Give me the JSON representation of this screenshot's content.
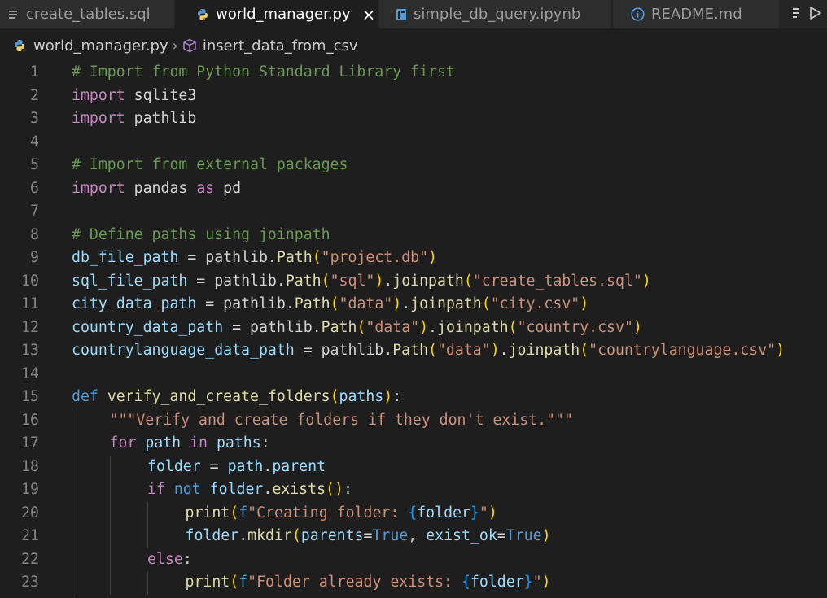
{
  "tabs": [
    {
      "label": "create_tables.sql",
      "icon": "sql-file-icon",
      "active": false
    },
    {
      "label": "world_manager.py",
      "icon": "python-file-icon",
      "active": true,
      "close": "×"
    },
    {
      "label": "simple_db_query.ipynb",
      "icon": "notebook-file-icon",
      "active": false
    },
    {
      "label": "README.md",
      "icon": "info-icon",
      "active": false
    }
  ],
  "tab_actions": {
    "icons": [
      "overflow-menu-icon",
      "run-icon"
    ]
  },
  "breadcrumb": {
    "file": "world_manager.py",
    "separator": "›",
    "symbol": "insert_data_from_csv",
    "symbol_icon": "method-cube-icon"
  },
  "colors": {
    "comment": "#6a9955",
    "keyword": "#569cd6",
    "control": "#c586c0",
    "string": "#ce9178",
    "function": "#dcdcaa",
    "variable": "#9cdcfe",
    "text": "#d4d4d4",
    "bracket1": "#ffd700",
    "bracket2": "#da70d6",
    "bracket3": "#179fff",
    "line_number": "#858585"
  },
  "editor": {
    "lines": [
      {
        "n": "1",
        "indent": 0,
        "tokens": [
          [
            "# Import from Python Standard Library first",
            "comment"
          ]
        ]
      },
      {
        "n": "2",
        "indent": 0,
        "tokens": [
          [
            "import",
            "control"
          ],
          [
            " ",
            "plain"
          ],
          [
            "sqlite3",
            "plain"
          ]
        ]
      },
      {
        "n": "3",
        "indent": 0,
        "tokens": [
          [
            "import",
            "control"
          ],
          [
            " ",
            "plain"
          ],
          [
            "pathlib",
            "plain"
          ]
        ]
      },
      {
        "n": "4",
        "indent": 0,
        "tokens": []
      },
      {
        "n": "5",
        "indent": 0,
        "tokens": [
          [
            "# Import from external packages",
            "comment"
          ]
        ]
      },
      {
        "n": "6",
        "indent": 0,
        "tokens": [
          [
            "import",
            "control"
          ],
          [
            " ",
            "plain"
          ],
          [
            "pandas",
            "plain"
          ],
          [
            " ",
            "plain"
          ],
          [
            "as",
            "control"
          ],
          [
            " ",
            "plain"
          ],
          [
            "pd",
            "plain"
          ]
        ]
      },
      {
        "n": "7",
        "indent": 0,
        "tokens": []
      },
      {
        "n": "8",
        "indent": 0,
        "tokens": [
          [
            "# Define paths using joinpath",
            "comment"
          ]
        ]
      },
      {
        "n": "9",
        "indent": 0,
        "tokens": [
          [
            "db_file_path",
            "var"
          ],
          [
            " = ",
            "plain"
          ],
          [
            "pathlib",
            "plain"
          ],
          [
            ".",
            "plain"
          ],
          [
            "Path",
            "func"
          ],
          [
            "(",
            "bracket1"
          ],
          [
            "\"project.db\"",
            "string"
          ],
          [
            ")",
            "bracket1"
          ]
        ]
      },
      {
        "n": "10",
        "indent": 0,
        "tokens": [
          [
            "sql_file_path",
            "var"
          ],
          [
            " = ",
            "plain"
          ],
          [
            "pathlib",
            "plain"
          ],
          [
            ".",
            "plain"
          ],
          [
            "Path",
            "func"
          ],
          [
            "(",
            "bracket1"
          ],
          [
            "\"sql\"",
            "string"
          ],
          [
            ")",
            "bracket1"
          ],
          [
            ".",
            "plain"
          ],
          [
            "joinpath",
            "func"
          ],
          [
            "(",
            "bracket1"
          ],
          [
            "\"create_tables.sql\"",
            "string"
          ],
          [
            ")",
            "bracket1"
          ]
        ]
      },
      {
        "n": "11",
        "indent": 0,
        "tokens": [
          [
            "city_data_path",
            "var"
          ],
          [
            " = ",
            "plain"
          ],
          [
            "pathlib",
            "plain"
          ],
          [
            ".",
            "plain"
          ],
          [
            "Path",
            "func"
          ],
          [
            "(",
            "bracket1"
          ],
          [
            "\"data\"",
            "string"
          ],
          [
            ")",
            "bracket1"
          ],
          [
            ".",
            "plain"
          ],
          [
            "joinpath",
            "func"
          ],
          [
            "(",
            "bracket1"
          ],
          [
            "\"city.csv\"",
            "string"
          ],
          [
            ")",
            "bracket1"
          ]
        ]
      },
      {
        "n": "12",
        "indent": 0,
        "tokens": [
          [
            "country_data_path",
            "var"
          ],
          [
            " = ",
            "plain"
          ],
          [
            "pathlib",
            "plain"
          ],
          [
            ".",
            "plain"
          ],
          [
            "Path",
            "func"
          ],
          [
            "(",
            "bracket1"
          ],
          [
            "\"data\"",
            "string"
          ],
          [
            ")",
            "bracket1"
          ],
          [
            ".",
            "plain"
          ],
          [
            "joinpath",
            "func"
          ],
          [
            "(",
            "bracket1"
          ],
          [
            "\"country.csv\"",
            "string"
          ],
          [
            ")",
            "bracket1"
          ]
        ]
      },
      {
        "n": "13",
        "indent": 0,
        "tokens": [
          [
            "countrylanguage_data_path",
            "var"
          ],
          [
            " = ",
            "plain"
          ],
          [
            "pathlib",
            "plain"
          ],
          [
            ".",
            "plain"
          ],
          [
            "Path",
            "func"
          ],
          [
            "(",
            "bracket1"
          ],
          [
            "\"data\"",
            "string"
          ],
          [
            ")",
            "bracket1"
          ],
          [
            ".",
            "plain"
          ],
          [
            "joinpath",
            "func"
          ],
          [
            "(",
            "bracket1"
          ],
          [
            "\"countrylanguage.csv\"",
            "string"
          ],
          [
            ")",
            "bracket1"
          ]
        ]
      },
      {
        "n": "14",
        "indent": 0,
        "tokens": []
      },
      {
        "n": "15",
        "indent": 0,
        "tokens": [
          [
            "def",
            "keyword"
          ],
          [
            " ",
            "plain"
          ],
          [
            "verify_and_create_folders",
            "func"
          ],
          [
            "(",
            "bracket1"
          ],
          [
            "paths",
            "var"
          ],
          [
            ")",
            "bracket1"
          ],
          [
            ":",
            "plain"
          ]
        ]
      },
      {
        "n": "16",
        "indent": 1,
        "tokens": [
          [
            "\"\"\"Verify and create folders if they don't exist.\"\"\"",
            "string"
          ]
        ]
      },
      {
        "n": "17",
        "indent": 1,
        "tokens": [
          [
            "for",
            "control"
          ],
          [
            " ",
            "plain"
          ],
          [
            "path",
            "var"
          ],
          [
            " ",
            "plain"
          ],
          [
            "in",
            "control"
          ],
          [
            " ",
            "plain"
          ],
          [
            "paths",
            "var"
          ],
          [
            ":",
            "plain"
          ]
        ]
      },
      {
        "n": "18",
        "indent": 2,
        "tokens": [
          [
            "folder",
            "var"
          ],
          [
            " = ",
            "plain"
          ],
          [
            "path",
            "var"
          ],
          [
            ".",
            "plain"
          ],
          [
            "parent",
            "var"
          ]
        ]
      },
      {
        "n": "19",
        "indent": 2,
        "tokens": [
          [
            "if",
            "control"
          ],
          [
            " ",
            "plain"
          ],
          [
            "not",
            "keyword"
          ],
          [
            " ",
            "plain"
          ],
          [
            "folder",
            "var"
          ],
          [
            ".",
            "plain"
          ],
          [
            "exists",
            "func"
          ],
          [
            "()",
            "bracket1"
          ],
          [
            ":",
            "plain"
          ]
        ]
      },
      {
        "n": "20",
        "indent": 3,
        "tokens": [
          [
            "print",
            "func"
          ],
          [
            "(",
            "bracket1"
          ],
          [
            "f",
            "fprefix"
          ],
          [
            "\"Creating folder: ",
            "string"
          ],
          [
            "{",
            "bracket3"
          ],
          [
            "folder",
            "var"
          ],
          [
            "}",
            "bracket3"
          ],
          [
            "\"",
            "string"
          ],
          [
            ")",
            "bracket1"
          ]
        ]
      },
      {
        "n": "21",
        "indent": 3,
        "tokens": [
          [
            "folder",
            "var"
          ],
          [
            ".",
            "plain"
          ],
          [
            "mkdir",
            "func"
          ],
          [
            "(",
            "bracket1"
          ],
          [
            "parents",
            "var"
          ],
          [
            "=",
            "plain"
          ],
          [
            "True",
            "const"
          ],
          [
            ", ",
            "plain"
          ],
          [
            "exist_ok",
            "var"
          ],
          [
            "=",
            "plain"
          ],
          [
            "True",
            "const"
          ],
          [
            ")",
            "bracket1"
          ]
        ]
      },
      {
        "n": "22",
        "indent": 2,
        "tokens": [
          [
            "else",
            "control"
          ],
          [
            ":",
            "plain"
          ]
        ]
      },
      {
        "n": "23",
        "indent": 3,
        "tokens": [
          [
            "print",
            "func"
          ],
          [
            "(",
            "bracket1"
          ],
          [
            "f",
            "fprefix"
          ],
          [
            "\"Folder already exists: ",
            "string"
          ],
          [
            "{",
            "bracket3"
          ],
          [
            "folder",
            "var"
          ],
          [
            "}",
            "bracket3"
          ],
          [
            "\"",
            "string"
          ],
          [
            ")",
            "bracket1"
          ]
        ]
      }
    ]
  }
}
